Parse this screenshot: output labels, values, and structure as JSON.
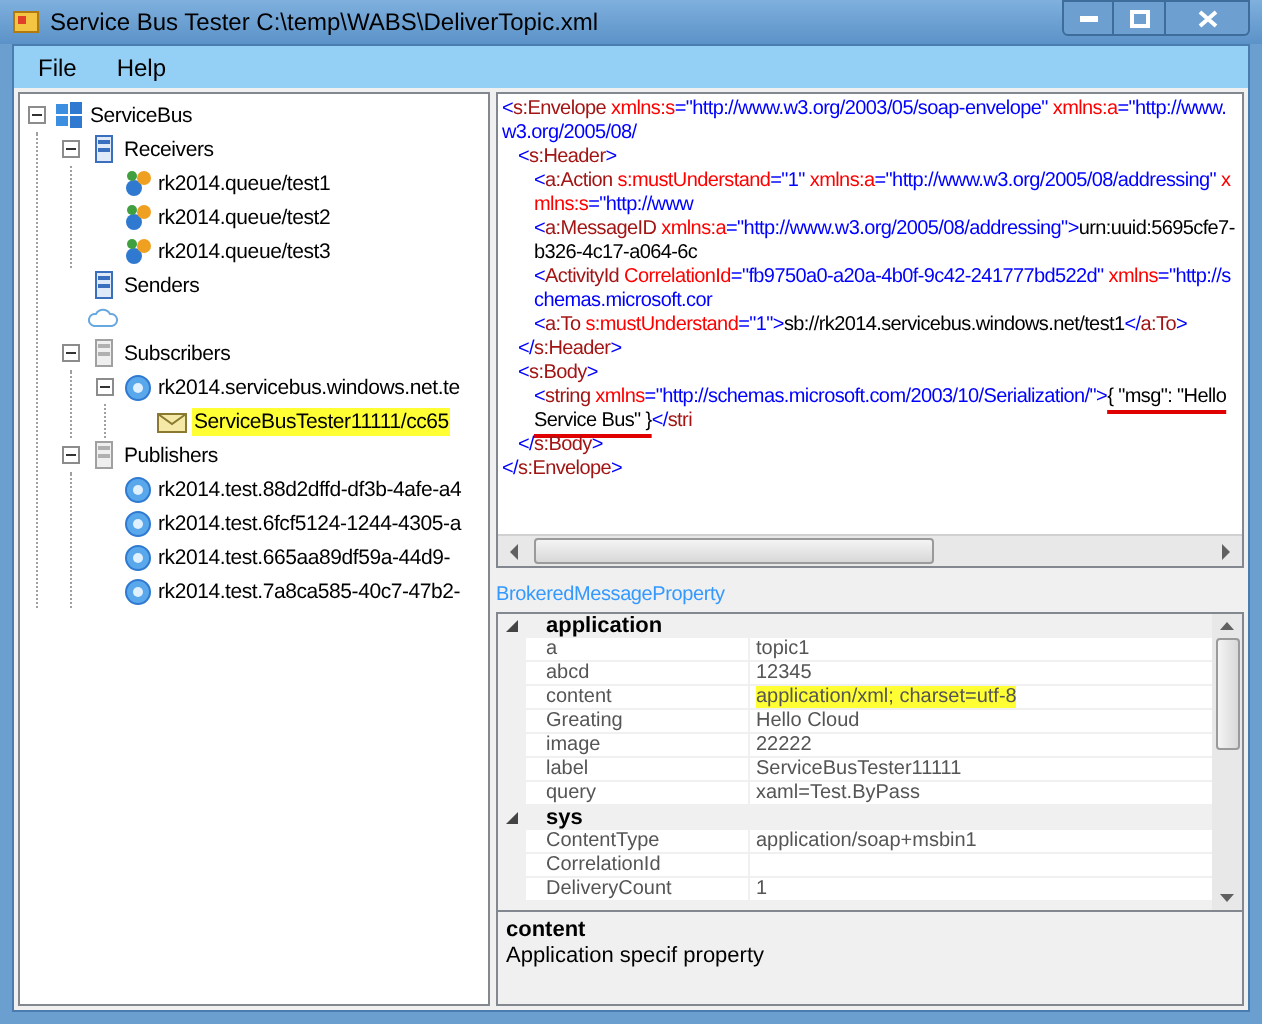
{
  "window": {
    "title": "Service Bus Tester C:\\temp\\WABS\\DeliverTopic.xml"
  },
  "menu": [
    "File",
    "Help"
  ],
  "tree": [
    {
      "label": "ServiceBus",
      "kind": "root",
      "expanded": true,
      "children": [
        {
          "label": "Receivers",
          "kind": "server",
          "expanded": true,
          "children": [
            {
              "label": "rk2014.queue/test1",
              "kind": "queue"
            },
            {
              "label": "rk2014.queue/test2",
              "kind": "queue"
            },
            {
              "label": "rk2014.queue/test3",
              "kind": "queue"
            }
          ]
        },
        {
          "label": "Senders",
          "kind": "server"
        },
        {
          "kind": "cloud"
        },
        {
          "label": "Subscribers",
          "kind": "grayserver",
          "expanded": true,
          "children": [
            {
              "label": "rk2014.servicebus.windows.net.te",
              "kind": "topic",
              "expanded": true,
              "children": [
                {
                  "label": "ServiceBusTester11111/cc65",
                  "kind": "message",
                  "highlighted": true
                }
              ]
            }
          ]
        },
        {
          "label": "Publishers",
          "kind": "grayserver",
          "expanded": true,
          "children": [
            {
              "label": "rk2014.test.88d2dffd-df3b-4afe-a4",
              "kind": "topic"
            },
            {
              "label": "rk2014.test.6fcf5124-1244-4305-a",
              "kind": "topic"
            },
            {
              "label": "rk2014.test.665aa89df59a-44d9-",
              "kind": "topic"
            },
            {
              "label": "rk2014.test.7a8ca585-40c7-47b2-",
              "kind": "topic"
            }
          ]
        }
      ]
    }
  ],
  "xml": [
    {
      "tokens": [
        {
          "kind": "punct",
          "text": "<"
        },
        {
          "kind": "tag",
          "text": "s:Envelope"
        },
        {
          "kind": "attr",
          "text": " xmlns:s"
        },
        {
          "kind": "value",
          "text": "=\"http://www.w3.org/2003/05/soap-envelope\""
        },
        {
          "kind": "attr",
          "text": " xmlns:a"
        },
        {
          "kind": "value",
          "text": "=\"http://www.w3.org/2005/08/"
        }
      ],
      "children": [
        {
          "tokens": [
            {
              "kind": "punct",
              "text": "<"
            },
            {
              "kind": "tag",
              "text": "s:Header"
            },
            {
              "kind": "punct",
              "text": ">"
            }
          ],
          "children": [
            {
              "tokens": [
                {
                  "kind": "punct",
                  "text": "<"
                },
                {
                  "kind": "tag",
                  "text": "a:Action"
                },
                {
                  "kind": "attr",
                  "text": " s:mustUnderstand"
                },
                {
                  "kind": "value",
                  "text": "=\"1\""
                },
                {
                  "kind": "attr",
                  "text": " xmlns:a"
                },
                {
                  "kind": "value",
                  "text": "=\"http://www.w3.org/2005/08/addressing\""
                },
                {
                  "kind": "attr",
                  "text": " xmlns:s"
                },
                {
                  "kind": "value",
                  "text": "=\"http://www"
                }
              ]
            },
            {
              "tokens": [
                {
                  "kind": "punct",
                  "text": "<"
                },
                {
                  "kind": "tag",
                  "text": "a:MessageID"
                },
                {
                  "kind": "attr",
                  "text": " xmlns:a"
                },
                {
                  "kind": "value",
                  "text": "=\"http://www.w3.org/2005/08/addressing\""
                },
                {
                  "kind": "punct",
                  "text": ">"
                },
                {
                  "kind": "text",
                  "text": "urn:uuid:5695cfe7-b326-4c17-a064-6c"
                }
              ]
            },
            {
              "tokens": [
                {
                  "kind": "punct",
                  "text": "<"
                },
                {
                  "kind": "tag",
                  "text": "ActivityId"
                },
                {
                  "kind": "attr",
                  "text": " CorrelationId"
                },
                {
                  "kind": "value",
                  "text": "=\"fb9750a0-a20a-4b0f-9c42-241777bd522d\""
                },
                {
                  "kind": "attr",
                  "text": " xmlns"
                },
                {
                  "kind": "value",
                  "text": "=\"http://schemas.microsoft.cor"
                }
              ]
            },
            {
              "tokens": [
                {
                  "kind": "punct",
                  "text": "<"
                },
                {
                  "kind": "tag",
                  "text": "a:To"
                },
                {
                  "kind": "attr",
                  "text": " s:mustUnderstand"
                },
                {
                  "kind": "value",
                  "text": "=\"1\""
                },
                {
                  "kind": "punct",
                  "text": ">"
                },
                {
                  "kind": "text",
                  "text": "sb://rk2014.servicebus.windows.net/test1"
                },
                {
                  "kind": "punct",
                  "text": "</"
                },
                {
                  "kind": "tag",
                  "text": "a:To"
                },
                {
                  "kind": "punct",
                  "text": ">"
                }
              ]
            }
          ]
        },
        {
          "tokens": [
            {
              "kind": "punct",
              "text": "</"
            },
            {
              "kind": "tag",
              "text": "s:Header"
            },
            {
              "kind": "punct",
              "text": ">"
            }
          ]
        },
        {
          "tokens": [
            {
              "kind": "punct",
              "text": "<"
            },
            {
              "kind": "tag",
              "text": "s:Body"
            },
            {
              "kind": "punct",
              "text": ">"
            }
          ],
          "children": [
            {
              "tokens": [
                {
                  "kind": "punct",
                  "text": "<"
                },
                {
                  "kind": "tag",
                  "text": "string"
                },
                {
                  "kind": "attr",
                  "text": " xmlns"
                },
                {
                  "kind": "value",
                  "text": "=\"http://schemas.microsoft.com/2003/10/Serialization/\""
                },
                {
                  "kind": "punct",
                  "text": ">"
                },
                {
                  "kind": "text",
                  "text": "{ \"msg\": \"Hello Service Bus\" }",
                  "underlined": true
                },
                {
                  "kind": "punct",
                  "text": "</"
                },
                {
                  "kind": "tag",
                  "text": "stri"
                }
              ]
            }
          ]
        },
        {
          "tokens": [
            {
              "kind": "punct",
              "text": "</"
            },
            {
              "kind": "tag",
              "text": "s:Body"
            },
            {
              "kind": "punct",
              "text": ">"
            }
          ]
        }
      ]
    },
    {
      "tokens": [
        {
          "kind": "punct",
          "text": "</"
        },
        {
          "kind": "tag",
          "text": "s:Envelope"
        },
        {
          "kind": "punct",
          "text": ">"
        }
      ]
    }
  ],
  "properties_label": "BrokeredMessageProperty",
  "properties": [
    {
      "name": "application",
      "expanded": true,
      "rows": [
        {
          "name": "a",
          "value": "topic1"
        },
        {
          "name": "abcd",
          "value": "12345"
        },
        {
          "name": "content",
          "value": "application/xml; charset=utf-8",
          "highlighted": true
        },
        {
          "name": "Greating",
          "value": "Hello Cloud"
        },
        {
          "name": "image",
          "value": "22222"
        },
        {
          "name": "label",
          "value": "ServiceBusTester11111"
        },
        {
          "name": "query",
          "value": "xaml=Test.ByPass"
        }
      ]
    },
    {
      "name": "sys",
      "expanded": true,
      "rows": [
        {
          "name": "ContentType",
          "value": "application/soap+msbin1"
        },
        {
          "name": "CorrelationId"
        },
        {
          "name": "DeliveryCount",
          "value": "1"
        }
      ]
    }
  ],
  "description": {
    "title": "content",
    "text": "Application specif property"
  }
}
